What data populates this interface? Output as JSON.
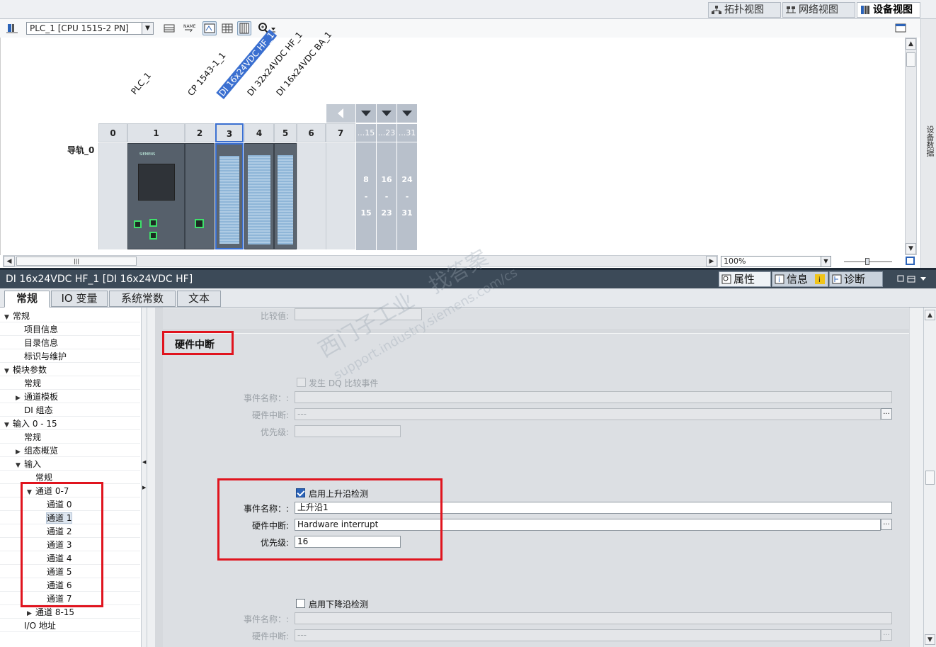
{
  "view_tabs": {
    "topology": "拓扑视图",
    "network": "网络视图",
    "device": "设备视图"
  },
  "toolbar": {
    "device_select": "PLC_1 [CPU 1515-2 PN]",
    "zoom_value": "100%"
  },
  "rack": {
    "rail_label": "导轨_0",
    "module_labels": [
      "PLC_1",
      "CP 1543-1_1",
      "DI 16x24VDC HF_1",
      "DI 32x24VDC HF_1",
      "DI 16x24VDC BA_1"
    ],
    "slots": [
      "0",
      "1",
      "2",
      "3",
      "4",
      "5",
      "6",
      "7"
    ],
    "expansion_headers": [
      "...15",
      "...23",
      "...31"
    ],
    "expansion_ranges": [
      {
        "from": "8",
        "dash": "-",
        "to": "15"
      },
      {
        "from": "16",
        "dash": "-",
        "to": "23"
      },
      {
        "from": "24",
        "dash": "-",
        "to": "31"
      }
    ],
    "cpu_brand": "SIEMENS"
  },
  "side_tab": "设备数据",
  "inspector": {
    "title": "DI 16x24VDC HF_1 [DI 16x24VDC HF]",
    "tabs": {
      "properties": "属性",
      "info": "信息",
      "diagnostics": "诊断"
    },
    "subtabs": [
      "常规",
      "IO 变量",
      "系统常数",
      "文本"
    ]
  },
  "tree": [
    {
      "label": "常规",
      "level": 0,
      "exp": "▼"
    },
    {
      "label": "项目信息",
      "level": 1,
      "exp": ""
    },
    {
      "label": "目录信息",
      "level": 1,
      "exp": ""
    },
    {
      "label": "标识与维护",
      "level": 1,
      "exp": ""
    },
    {
      "label": "模块参数",
      "level": 0,
      "exp": "▼"
    },
    {
      "label": "常规",
      "level": 1,
      "exp": ""
    },
    {
      "label": "通道模板",
      "level": 1,
      "exp": "▶"
    },
    {
      "label": "DI 组态",
      "level": 1,
      "exp": ""
    },
    {
      "label": "输入 0 - 15",
      "level": 0,
      "exp": "▼"
    },
    {
      "label": "常规",
      "level": 1,
      "exp": ""
    },
    {
      "label": "组态概览",
      "level": 1,
      "exp": "▶"
    },
    {
      "label": "输入",
      "level": 1,
      "exp": "▼"
    },
    {
      "label": "常规",
      "level": 2,
      "exp": ""
    },
    {
      "label": "通道 0-7",
      "level": 2,
      "exp": "▼"
    },
    {
      "label": "通道 0",
      "level": 3,
      "exp": ""
    },
    {
      "label": "通道 1",
      "level": 3,
      "exp": "",
      "selected": true
    },
    {
      "label": "通道 2",
      "level": 3,
      "exp": ""
    },
    {
      "label": "通道 3",
      "level": 3,
      "exp": ""
    },
    {
      "label": "通道 4",
      "level": 3,
      "exp": ""
    },
    {
      "label": "通道 5",
      "level": 3,
      "exp": ""
    },
    {
      "label": "通道 6",
      "level": 3,
      "exp": ""
    },
    {
      "label": "通道 7",
      "level": 3,
      "exp": ""
    },
    {
      "label": "通道 8-15",
      "level": 2,
      "exp": "▶"
    },
    {
      "label": "I/O 地址",
      "level": 1,
      "exp": ""
    }
  ],
  "form": {
    "compare_value_label": "比较值:",
    "section_title": "硬件中断",
    "dq_compare": {
      "checkbox_label": "发生 DQ 比较事件",
      "event_name_label": "事件名称：:",
      "hw_interrupt_label": "硬件中断:",
      "hw_interrupt_value": "---",
      "priority_label": "优先级:"
    },
    "rising_edge": {
      "checkbox_label": "启用上升沿检测",
      "checked": true,
      "event_name_label": "事件名称：:",
      "event_name_value": "上升沿1",
      "hw_interrupt_label": "硬件中断:",
      "hw_interrupt_value": "Hardware interrupt",
      "priority_label": "优先级:",
      "priority_value": "16"
    },
    "falling_edge": {
      "checkbox_label": "启用下降沿检测",
      "checked": false,
      "event_name_label": "事件名称：:",
      "hw_interrupt_label": "硬件中断:",
      "hw_interrupt_value": "---"
    },
    "ellipsis": "..."
  },
  "watermark": {
    "line1": "西门子工业　找答案",
    "line2": "support.industry.siemens.com/cs"
  },
  "colors": {
    "highlight_red": "#e0141e",
    "selected_module": "#3a6fd0",
    "header_dark": "#3c4a58"
  }
}
